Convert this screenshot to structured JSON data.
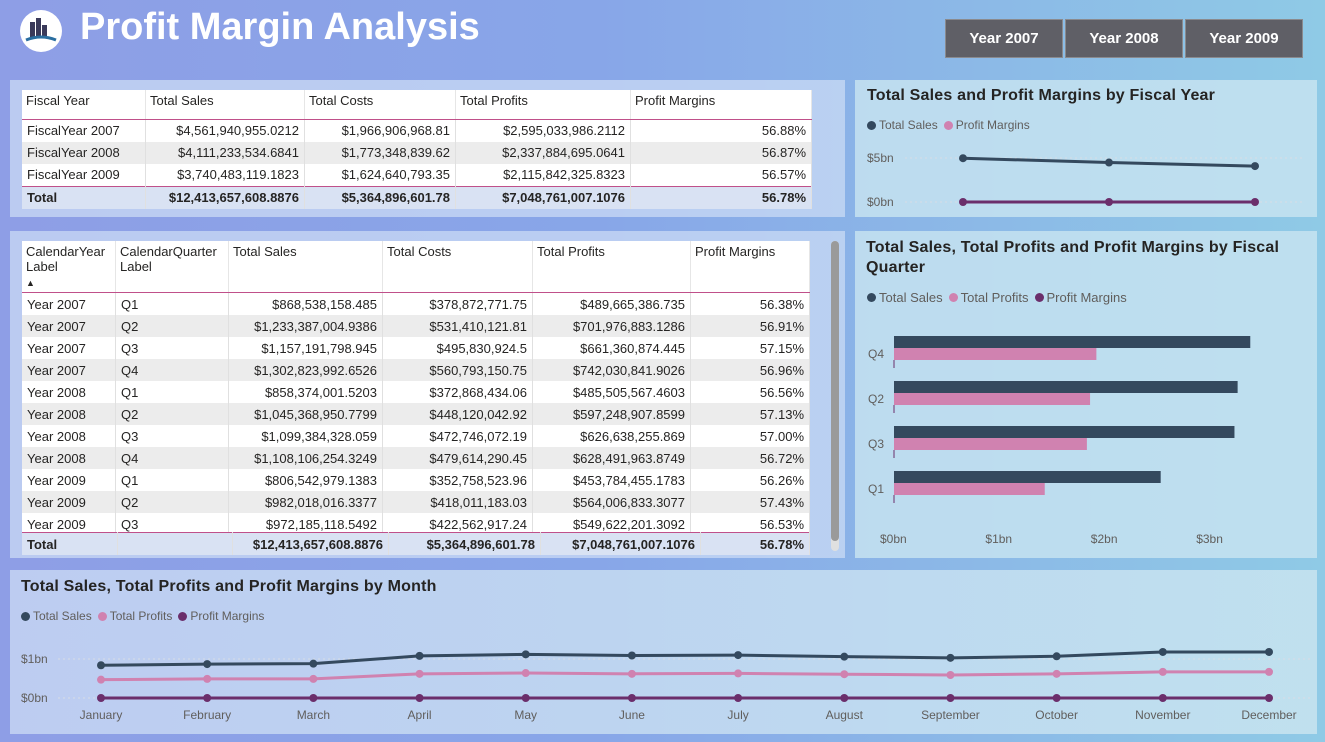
{
  "header": {
    "title": "Profit Margin Analysis"
  },
  "year_buttons": [
    "Year 2007",
    "Year 2008",
    "Year 2009"
  ],
  "fiscal_table": {
    "columns": [
      "Fiscal Year",
      "Total Sales",
      "Total Costs",
      "Total Profits",
      "Profit Margins"
    ],
    "rows": [
      [
        "FiscalYear 2007",
        "$4,561,940,955.0212",
        "$1,966,906,968.81",
        "$2,595,033,986.2112",
        "56.88%"
      ],
      [
        "FiscalYear 2008",
        "$4,111,233,534.6841",
        "$1,773,348,839.62",
        "$2,337,884,695.0641",
        "56.87%"
      ],
      [
        "FiscalYear 2009",
        "$3,740,483,119.1823",
        "$1,624,640,793.35",
        "$2,115,842,325.8323",
        "56.57%"
      ]
    ],
    "total": [
      "Total",
      "$12,413,657,608.8876",
      "$5,364,896,601.78",
      "$7,048,761,007.1076",
      "56.78%"
    ]
  },
  "quarter_table": {
    "columns": [
      "CalendarYear Label",
      "CalendarQuarter Label",
      "Total Sales",
      "Total Costs",
      "Total Profits",
      "Profit Margins"
    ],
    "rows": [
      [
        "Year 2007",
        "Q1",
        "$868,538,158.485",
        "$378,872,771.75",
        "$489,665,386.735",
        "56.38%"
      ],
      [
        "Year 2007",
        "Q2",
        "$1,233,387,004.9386",
        "$531,410,121.81",
        "$701,976,883.1286",
        "56.91%"
      ],
      [
        "Year 2007",
        "Q3",
        "$1,157,191,798.945",
        "$495,830,924.5",
        "$661,360,874.445",
        "57.15%"
      ],
      [
        "Year 2007",
        "Q4",
        "$1,302,823,992.6526",
        "$560,793,150.75",
        "$742,030,841.9026",
        "56.96%"
      ],
      [
        "Year 2008",
        "Q1",
        "$858,374,001.5203",
        "$372,868,434.06",
        "$485,505,567.4603",
        "56.56%"
      ],
      [
        "Year 2008",
        "Q2",
        "$1,045,368,950.7799",
        "$448,120,042.92",
        "$597,248,907.8599",
        "57.13%"
      ],
      [
        "Year 2008",
        "Q3",
        "$1,099,384,328.059",
        "$472,746,072.19",
        "$626,638,255.869",
        "57.00%"
      ],
      [
        "Year 2008",
        "Q4",
        "$1,108,106,254.3249",
        "$479,614,290.45",
        "$628,491,963.8749",
        "56.72%"
      ],
      [
        "Year 2009",
        "Q1",
        "$806,542,979.1383",
        "$352,758,523.96",
        "$453,784,455.1783",
        "56.26%"
      ],
      [
        "Year 2009",
        "Q2",
        "$982,018,016.3377",
        "$418,011,183.03",
        "$564,006,833.3077",
        "57.43%"
      ],
      [
        "Year 2009",
        "Q3",
        "$972,185,118.5492",
        "$422,562,917.24",
        "$549,622,201.3092",
        "56.53%"
      ]
    ],
    "total": [
      "Total",
      "",
      "$12,413,657,608.8876",
      "$5,364,896,601.78",
      "$7,048,761,007.1076",
      "56.78%"
    ]
  },
  "colors": {
    "total_sales": "#34495e",
    "total_profits": "#d082b0",
    "profit_margins": "#6b2e6b"
  },
  "chart_data": [
    {
      "type": "line",
      "title": "Total Sales and Profit Margins by Fiscal Year",
      "legend": [
        "Total Sales",
        "Profit Margins"
      ],
      "legend_position": "top-left",
      "x": [
        "FiscalYear 2007",
        "FiscalYear 2008",
        "FiscalYear 2009"
      ],
      "x_labels_visible": false,
      "yticks": [
        "$0bn",
        "$5bn"
      ],
      "ylim": [
        0,
        5
      ],
      "grid": true,
      "series": [
        {
          "name": "Total Sales",
          "values": [
            4.56,
            4.11,
            3.74
          ]
        },
        {
          "name": "Profit Margins",
          "values": [
            5.688e-07,
            5.687e-07,
            5.657e-07
          ]
        }
      ]
    },
    {
      "type": "bar",
      "orientation": "horizontal",
      "title": "Total Sales, Total Profits and Profit Margins by Fiscal Quarter",
      "legend": [
        "Total Sales",
        "Total Profits",
        "Profit Margins"
      ],
      "legend_position": "top-left",
      "categories": [
        "Q4",
        "Q2",
        "Q3",
        "Q1"
      ],
      "xticks": [
        "$0bn",
        "$1bn",
        "$2bn",
        "$3bn"
      ],
      "xlim": [
        0,
        3.5
      ],
      "series": [
        {
          "name": "Total Sales",
          "values": [
            3.38,
            3.26,
            3.23,
            2.53
          ]
        },
        {
          "name": "Total Profits",
          "values": [
            1.92,
            1.86,
            1.83,
            1.43
          ]
        },
        {
          "name": "Profit Margins",
          "values": [
            5.688e-07,
            5.715e-07,
            5.69e-07,
            5.64e-07
          ]
        }
      ]
    },
    {
      "type": "line",
      "title": "Total Sales, Total Profits and Profit Margins by Month",
      "legend": [
        "Total Sales",
        "Total Profits",
        "Profit Margins"
      ],
      "legend_position": "top-left",
      "x": [
        "January",
        "February",
        "March",
        "April",
        "May",
        "June",
        "July",
        "August",
        "September",
        "October",
        "November",
        "December"
      ],
      "yticks": [
        "$0bn",
        "$1bn"
      ],
      "ylim": [
        0,
        1.5
      ],
      "grid": true,
      "series": [
        {
          "name": "Total Sales",
          "values": [
            0.84,
            0.87,
            0.88,
            1.08,
            1.12,
            1.09,
            1.1,
            1.06,
            1.03,
            1.07,
            1.18,
            1.18
          ]
        },
        {
          "name": "Total Profits",
          "values": [
            0.47,
            0.49,
            0.49,
            0.62,
            0.64,
            0.62,
            0.63,
            0.61,
            0.59,
            0.62,
            0.67,
            0.67
          ]
        },
        {
          "name": "Profit Margins",
          "values": [
            5.6e-07,
            5.6e-07,
            5.6e-07,
            5.7e-07,
            5.7e-07,
            5.7e-07,
            5.7e-07,
            5.7e-07,
            5.7e-07,
            5.7e-07,
            5.7e-07,
            5.7e-07
          ]
        }
      ]
    }
  ]
}
